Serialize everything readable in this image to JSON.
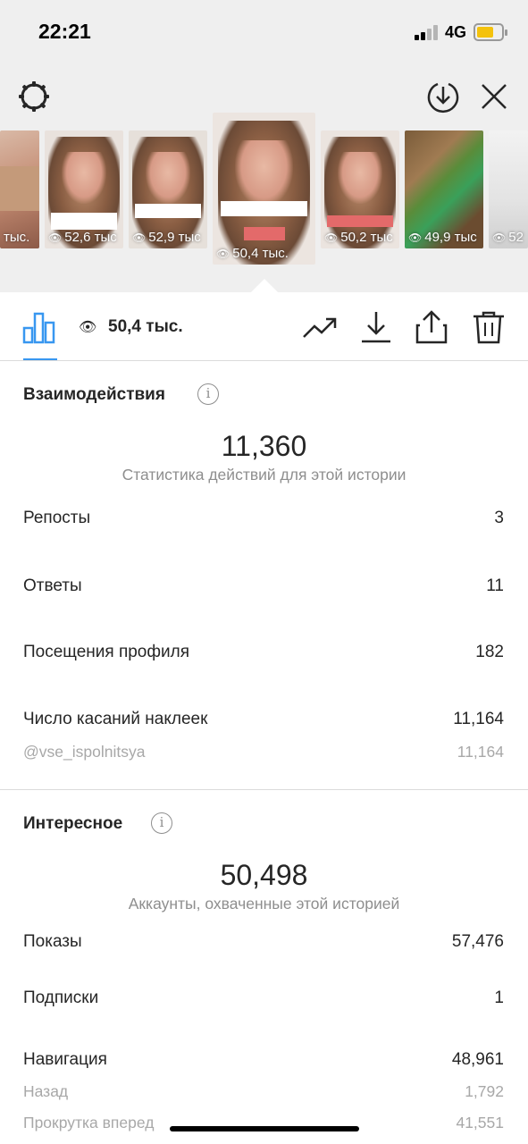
{
  "status_bar": {
    "time": "22:21",
    "network": "4G"
  },
  "thumbnails": [
    {
      "label": "тыс."
    },
    {
      "label": "52,6 тыс"
    },
    {
      "label": "52,9 тыс"
    },
    {
      "label": "50,4 тыс."
    },
    {
      "label": "50,2 тыс"
    },
    {
      "label": "49,9 тыс"
    },
    {
      "label": "52"
    }
  ],
  "toolbar": {
    "views": "50,4 тыс."
  },
  "interactions": {
    "title": "Взаимодействия",
    "total": "11,360",
    "caption": "Статистика действий для этой истории",
    "rows": [
      {
        "label": "Репосты",
        "value": "3"
      },
      {
        "label": "Ответы",
        "value": "11"
      },
      {
        "label": "Посещения профиля",
        "value": "182"
      },
      {
        "label": "Число касаний наклеек",
        "value": "11,164"
      }
    ],
    "sticker_sub": {
      "label": "@vse_ispolnitsya",
      "value": "11,164"
    }
  },
  "discovery": {
    "title": "Интересное",
    "total": "50,498",
    "caption": "Аккаунты, охваченные этой историей",
    "rows": [
      {
        "label": "Показы",
        "value": "57,476"
      },
      {
        "label": "Подписки",
        "value": "1"
      },
      {
        "label": "Навигация",
        "value": "48,961"
      }
    ],
    "nav_sub": [
      {
        "label": "Назад",
        "value": "1,792"
      },
      {
        "label": "Прокрутка вперед",
        "value": "41,551"
      }
    ]
  },
  "colors": {
    "accent": "#3897f0",
    "battery": "#f4c20d"
  }
}
